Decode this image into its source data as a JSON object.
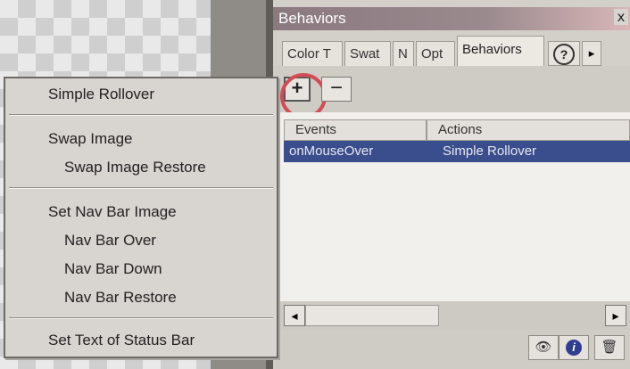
{
  "panel": {
    "title": "Behaviors",
    "close_glyph": "x",
    "tabs": [
      {
        "label": "Color T"
      },
      {
        "label": "Swat"
      },
      {
        "label": "N"
      },
      {
        "label": "Opt"
      },
      {
        "label": "Behaviors"
      }
    ],
    "help_glyph": "?",
    "tab_scroll_glyph": "▸",
    "add_glyph": "+",
    "remove_glyph": "−",
    "columns": [
      "Events",
      "Actions"
    ],
    "rows": [
      {
        "event": "onMouseOver",
        "action": "Simple Rollover"
      }
    ],
    "scroll_left_glyph": "◂",
    "scroll_right_glyph": "▸",
    "bottom_icons": [
      "eye-icon",
      "info-icon",
      "trash-icon"
    ],
    "info_glyph": "i",
    "trash_glyph": "🗑",
    "eye_glyph": "👁"
  },
  "menu": {
    "items": [
      {
        "label": "Simple Rollover"
      },
      {
        "label": "Swap Image"
      },
      {
        "label": "Swap Image Restore"
      },
      {
        "label": "Set Nav Bar Image"
      },
      {
        "label": "Nav Bar Over"
      },
      {
        "label": "Nav Bar Down"
      },
      {
        "label": "Nav Bar Restore"
      },
      {
        "label": "Set Text of Status Bar"
      }
    ]
  },
  "colors": {
    "selection": "#3a4d8c",
    "highlight_ring": "#d34b55"
  }
}
